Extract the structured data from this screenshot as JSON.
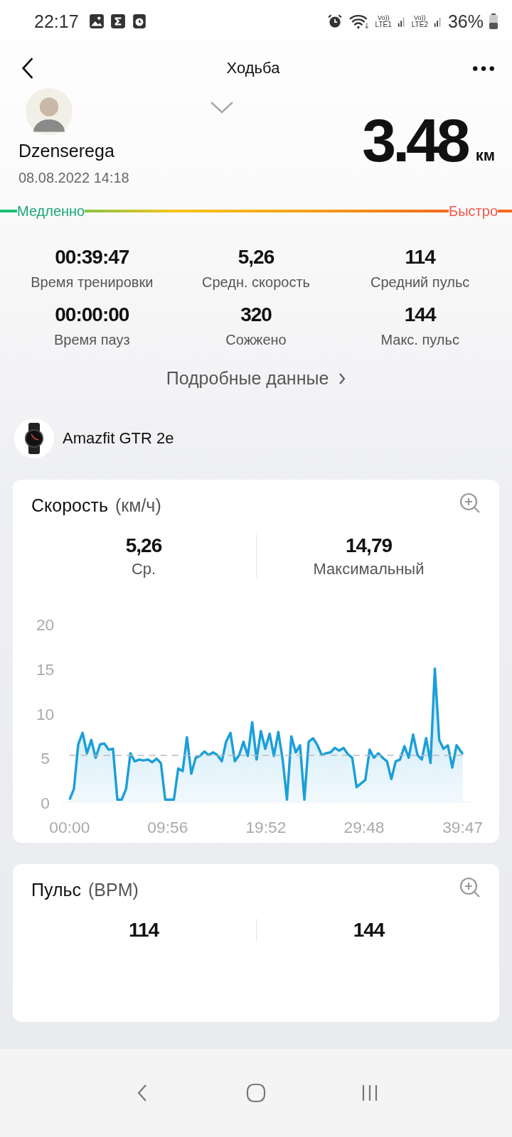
{
  "status_bar": {
    "time": "22:17",
    "volte1": "Vo))",
    "sim1": "LTE1",
    "volte2": "Vo))",
    "sim2": "LTE2",
    "battery": "36%"
  },
  "header": {
    "title": "Ходьба"
  },
  "profile": {
    "name": "Dzenserega",
    "date": "08.08.2022 14:18",
    "distance": "3.48",
    "unit": "км"
  },
  "pace_bar": {
    "slow": "Медленно",
    "fast": "Быстро"
  },
  "stats": [
    {
      "value": "00:39:47",
      "label": "Время тренировки"
    },
    {
      "value": "5,26",
      "label": "Средн. скорость"
    },
    {
      "value": "114",
      "label": "Средний пульс"
    },
    {
      "value": "00:00:00",
      "label": "Время пауз"
    },
    {
      "value": "320",
      "label": "Сожжено"
    },
    {
      "value": "144",
      "label": "Макс. пульс"
    }
  ],
  "details_link": "Подробные данные",
  "device": {
    "name": "Amazfit GTR 2e"
  },
  "speed_card": {
    "title": "Скорость",
    "unit": "(км/ч)",
    "summary": [
      {
        "value": "5,26",
        "label": "Ср."
      },
      {
        "value": "14,79",
        "label": "Максимальный"
      }
    ],
    "chart_data": {
      "type": "area",
      "xlim": [
        0,
        39.78
      ],
      "ylim": [
        0,
        20
      ],
      "yticks": [
        0,
        5,
        10,
        15,
        20
      ],
      "x": [
        0,
        0.44,
        0.88,
        1.32,
        1.76,
        2.2,
        2.64,
        3.08,
        3.52,
        3.96,
        4.4,
        4.84,
        5.28,
        5.72,
        6.16,
        6.6,
        7.04,
        7.48,
        7.92,
        8.36,
        8.8,
        9.24,
        9.68,
        10.12,
        10.56,
        11,
        11.44,
        11.88,
        12.32,
        12.76,
        13.2,
        13.64,
        14.08,
        14.52,
        14.96,
        15.4,
        15.84,
        16.28,
        16.72,
        17.16,
        17.6,
        18.04,
        18.48,
        18.92,
        19.36,
        19.8,
        20.24,
        20.68,
        21.12,
        21.56,
        22,
        22.44,
        22.88,
        23.32,
        23.76,
        24.2,
        24.64,
        25.08,
        25.52,
        25.96,
        26.4,
        26.84,
        27.28,
        27.72,
        28.16,
        28.6,
        29.04,
        29.48,
        29.92,
        30.36,
        30.8,
        31.24,
        31.68,
        32.12,
        32.56,
        33,
        33.44,
        33.88,
        34.32,
        34.76,
        35.2,
        35.64,
        36.08,
        36.52,
        36.96,
        37.4,
        37.84,
        38.28,
        38.72,
        39.16,
        39.6,
        39.78
      ],
      "xticks": [
        {
          "value": 0,
          "label": "00:00"
        },
        {
          "value": 9.93,
          "label": "09:56"
        },
        {
          "value": 19.87,
          "label": "19:52"
        },
        {
          "value": 29.8,
          "label": "29:48"
        },
        {
          "value": 39.78,
          "label": "39:47"
        }
      ],
      "series": [
        {
          "color": "#1a9fd8",
          "values": [
            0.3,
            1.5,
            6.5,
            7.8,
            5.5,
            7,
            5,
            6.5,
            6.6,
            5.9,
            6,
            0.3,
            0.3,
            1.5,
            5.5,
            4.6,
            4.8,
            4.7,
            4.8,
            4.5,
            4.9,
            4.4,
            0.3,
            0.3,
            0.3,
            3.8,
            3.5,
            7.3,
            3.2,
            5,
            5.2,
            5.7,
            5.3,
            5.6,
            5.3,
            4.6,
            6.8,
            7.8,
            4.6,
            5.3,
            6.8,
            5.2,
            9,
            4.8,
            8,
            6,
            7.7,
            5.2,
            7.9,
            4.8,
            0.3,
            7.4,
            5.6,
            6.4,
            0.3,
            6.8,
            7.2,
            6.4,
            5.3,
            5.5,
            5.6,
            6.1,
            5.8,
            6.1,
            5.4,
            5,
            1.7,
            2.1,
            2.5,
            5.9,
            5,
            5.5,
            5,
            4.6,
            2.6,
            4.6,
            4.8,
            6.3,
            5,
            7.6,
            5.3,
            4.8,
            7.2,
            4.4,
            15,
            7,
            6,
            6.4,
            3.9,
            6.4,
            5.7,
            5.4
          ]
        }
      ]
    }
  },
  "pulse_card": {
    "title": "Пульс",
    "unit": "(BPM)",
    "summary": [
      {
        "value": "114"
      },
      {
        "value": "144"
      }
    ]
  }
}
